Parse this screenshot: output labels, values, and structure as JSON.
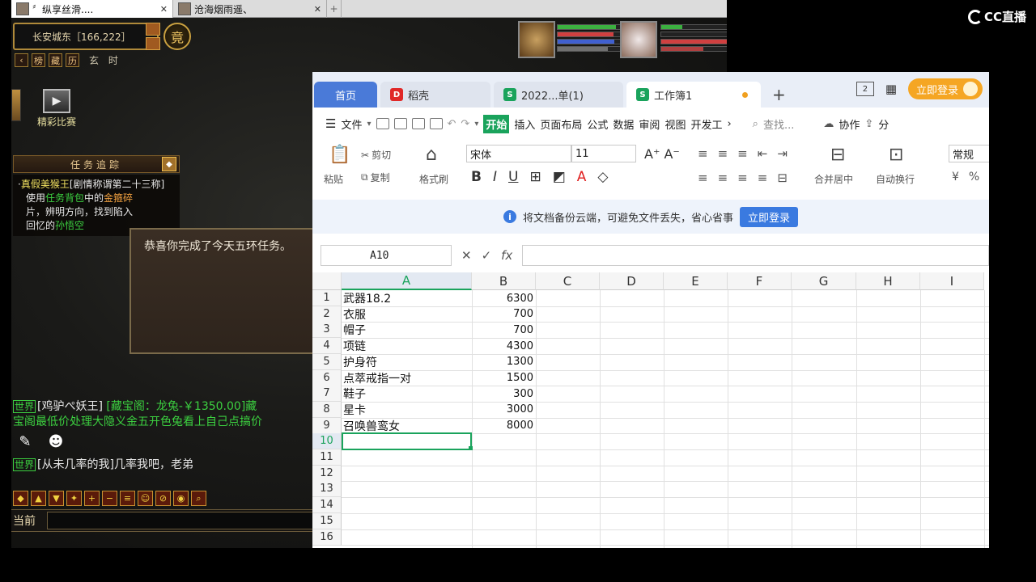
{
  "game": {
    "tabs": [
      {
        "label": "〞纵享丝滑...."
      },
      {
        "label": "沧海烟雨遥、"
      }
    ],
    "location": "长安城东［166,222］",
    "badge": "竟",
    "mini_buttons": [
      "榜",
      "藏",
      "历"
    ],
    "mini_text": "玄 时",
    "match_label": "精彩比赛",
    "quest": {
      "header": "任务追踪",
      "line1_title": "真假美猴王",
      "line1_sub": "[剧情称谓第二十三称]",
      "body_a": "使用",
      "body_b": "任务背包",
      "body_c": "中的",
      "body_d": "金箍碎",
      "body_e": "片，辨明方向，找到陷入",
      "body_f": "回忆的",
      "body_g": "孙悟空"
    },
    "dialog_text": "恭喜你完成了今天五环任务。",
    "chat": [
      {
        "channel": "世界",
        "user": "[鸡驴ぺ妖王]",
        "msg": "[藏宝阁：龙兔-￥1350.00]藏",
        "msg2": "宝阁最低价处理大隐义金五开色兔看上自己点搞价"
      },
      {
        "channel": "世界",
        "user": "[从未几率的我]",
        "msg": "几率我吧，老弟"
      }
    ],
    "input_label": "当前"
  },
  "overlay_logo": "CC直播",
  "sheet": {
    "tabs": [
      {
        "label": "首页"
      },
      {
        "label": "稻壳"
      },
      {
        "label": "2022...单(1)"
      },
      {
        "label": "工作簿1"
      }
    ],
    "login_top": "立即登录",
    "menu": [
      "文件",
      "开始",
      "插入",
      "页面布局",
      "公式",
      "数据",
      "审阅",
      "视图",
      "开发工"
    ],
    "menu_search": "查找...",
    "menu_right": [
      "协作",
      "分"
    ],
    "ribbon": {
      "paste": "粘贴",
      "cut": "剪切",
      "copy": "复制",
      "format_painter": "格式刷",
      "font": "宋体",
      "size": "11",
      "merge": "合并居中",
      "wrap": "自动换行",
      "numfmt": "常规"
    },
    "notice_text": "将文档备份云端，可避免文件丢失，省心省事",
    "notice_btn": "立即登录",
    "namebox": "A10",
    "columns": [
      "A",
      "B",
      "C",
      "D",
      "E",
      "F",
      "G",
      "H",
      "I"
    ],
    "rows": [
      "1",
      "2",
      "3",
      "4",
      "5",
      "6",
      "7",
      "8",
      "9",
      "10",
      "11",
      "12",
      "13",
      "14",
      "15",
      "16"
    ],
    "data": [
      {
        "item": "武器18.2",
        "price": "6300"
      },
      {
        "item": "衣服",
        "price": "700"
      },
      {
        "item": "帽子",
        "price": "700"
      },
      {
        "item": "项链",
        "price": "4300"
      },
      {
        "item": "护身符",
        "price": "1300"
      },
      {
        "item": "点萃戒指一对",
        "price": "1500"
      },
      {
        "item": "鞋子",
        "price": "300"
      },
      {
        "item": "星卡",
        "price": "3000"
      },
      {
        "item": "召唤兽鸾女",
        "price": "8000"
      }
    ],
    "accent": "#1aa35c"
  }
}
